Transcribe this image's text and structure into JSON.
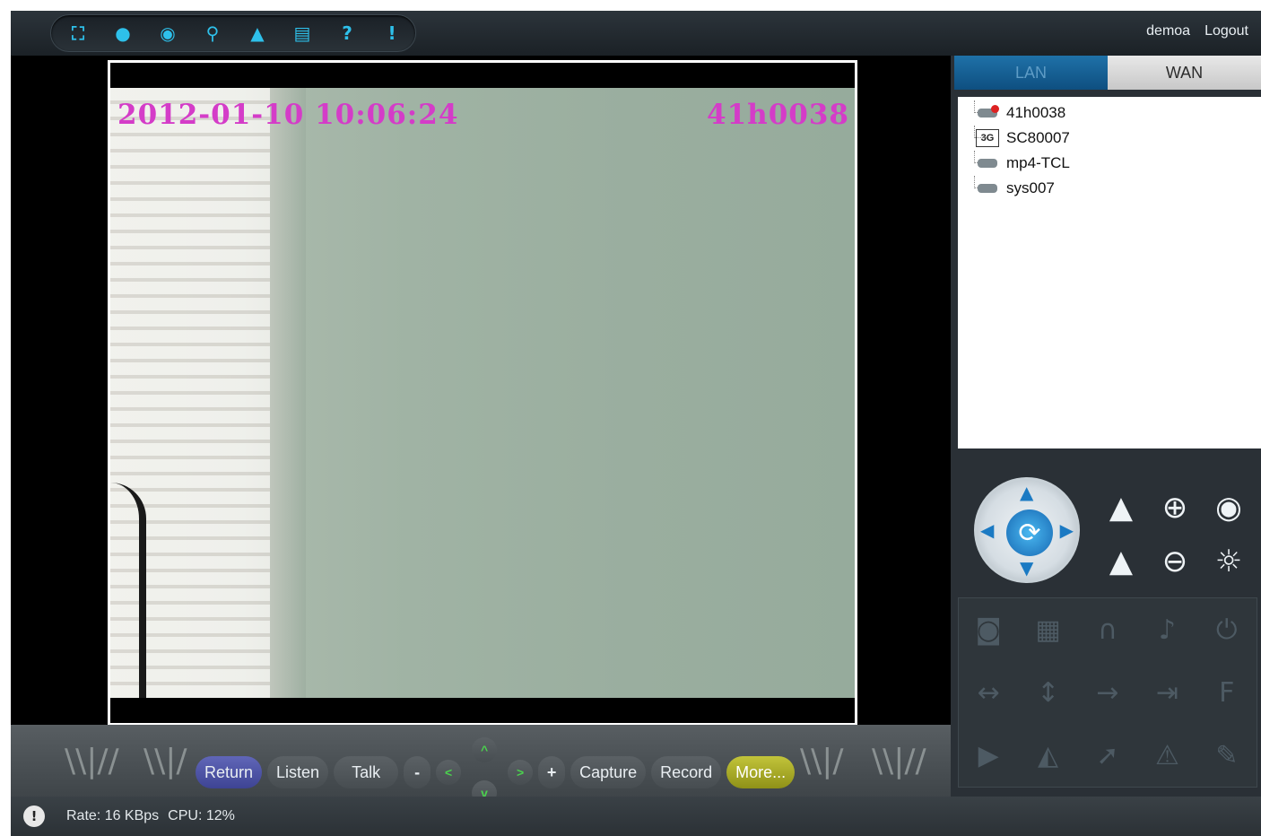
{
  "toolbar": {
    "buttons": [
      {
        "name": "fullscreen-icon",
        "glyph": "⛶"
      },
      {
        "name": "record-icon",
        "glyph": "●"
      },
      {
        "name": "camera-icon",
        "glyph": "◉"
      },
      {
        "name": "search-icon",
        "glyph": "⚲"
      },
      {
        "name": "lock-icon",
        "glyph": "🔒"
      },
      {
        "name": "save-icon",
        "glyph": "▤"
      },
      {
        "name": "help-icon",
        "glyph": "?"
      },
      {
        "name": "info-icon",
        "glyph": "!"
      }
    ]
  },
  "user": {
    "name": "demoa",
    "logout_label": "Logout"
  },
  "video": {
    "osd_time": "2012-01-10 10:06:24",
    "osd_device": "41h0038"
  },
  "controls": {
    "return_label": "Return",
    "listen_label": "Listen",
    "talk_label": "Talk",
    "minus_label": "-",
    "plus_label": "+",
    "left_label": "<",
    "right_label": ">",
    "up_label": "^",
    "down_label": "v",
    "capture_label": "Capture",
    "record_label": "Record",
    "more_label": "More..."
  },
  "tabs": {
    "lan_label": "LAN",
    "wan_label": "WAN"
  },
  "devices": [
    {
      "label": "41h0038",
      "icon": "camera-alert-icon"
    },
    {
      "label": "SC80007",
      "icon": "3g-device-icon",
      "badge": "3G"
    },
    {
      "label": "mp4-TCL",
      "icon": "camera-icon"
    },
    {
      "label": "sys007",
      "icon": "camera-icon"
    }
  ],
  "status": {
    "rate_label": "Rate: 16 KBps",
    "cpu_label": "CPU:  12%"
  }
}
